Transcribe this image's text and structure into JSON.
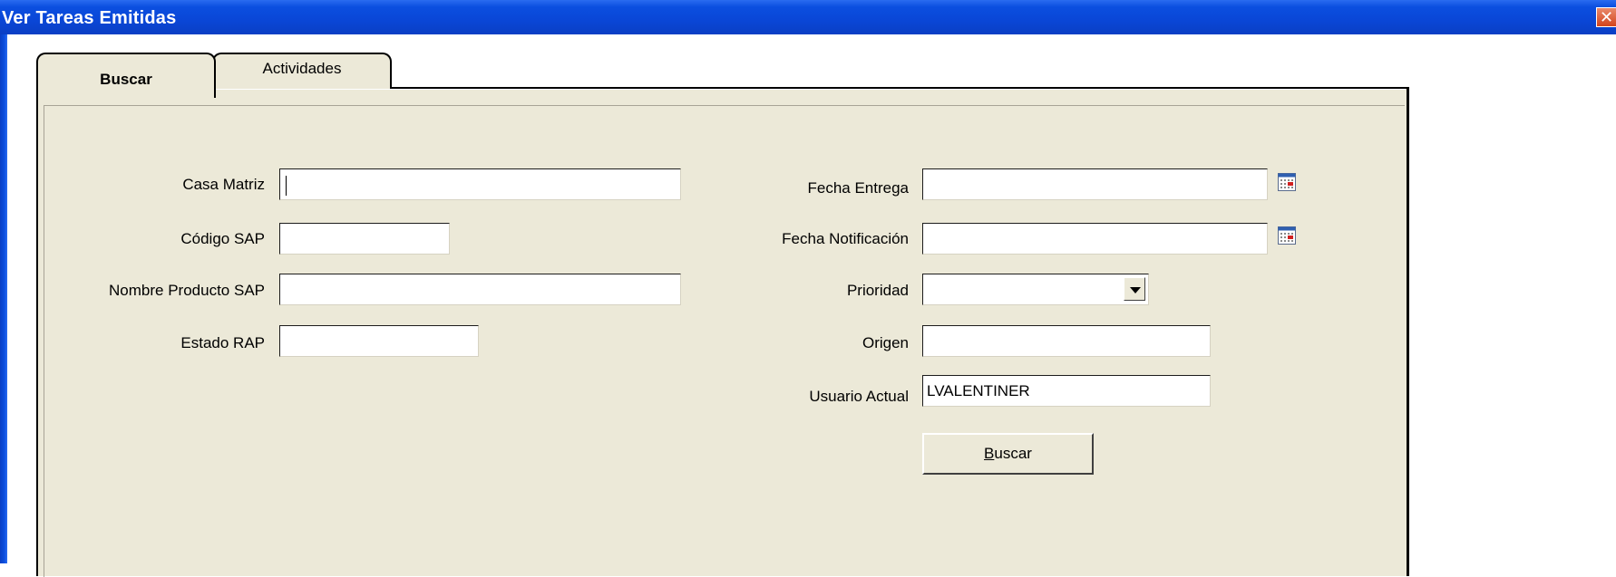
{
  "window": {
    "title": "Ver Tareas Emitidas",
    "close_label": "✕"
  },
  "tabs": [
    {
      "label": "Buscar",
      "active": true
    },
    {
      "label": "Actividades",
      "active": false
    }
  ],
  "form": {
    "left": {
      "casa_matriz": {
        "label": "Casa Matriz",
        "value": ""
      },
      "codigo_sap": {
        "label": "Código SAP",
        "value": ""
      },
      "nombre_producto_sap": {
        "label": "Nombre Producto SAP",
        "value": ""
      },
      "estado_rap": {
        "label": "Estado RAP",
        "value": ""
      }
    },
    "right": {
      "fecha_entrega": {
        "label": "Fecha Entrega",
        "value": ""
      },
      "fecha_notificacion": {
        "label": "Fecha Notificación",
        "value": ""
      },
      "prioridad": {
        "label": "Prioridad",
        "value": ""
      },
      "origen": {
        "label": "Origen",
        "value": ""
      },
      "usuario_actual": {
        "label": "Usuario Actual",
        "value": "LVALENTINER"
      }
    },
    "search_button": {
      "mnemonic": "B",
      "rest": "uscar"
    }
  },
  "icons": {
    "calendar": "calendar-icon",
    "dropdown": "chevron-down-icon",
    "close": "close-icon"
  },
  "colors": {
    "titlebar": "#0b4fe0",
    "panel": "#ece9d8",
    "close": "#d3441c"
  }
}
